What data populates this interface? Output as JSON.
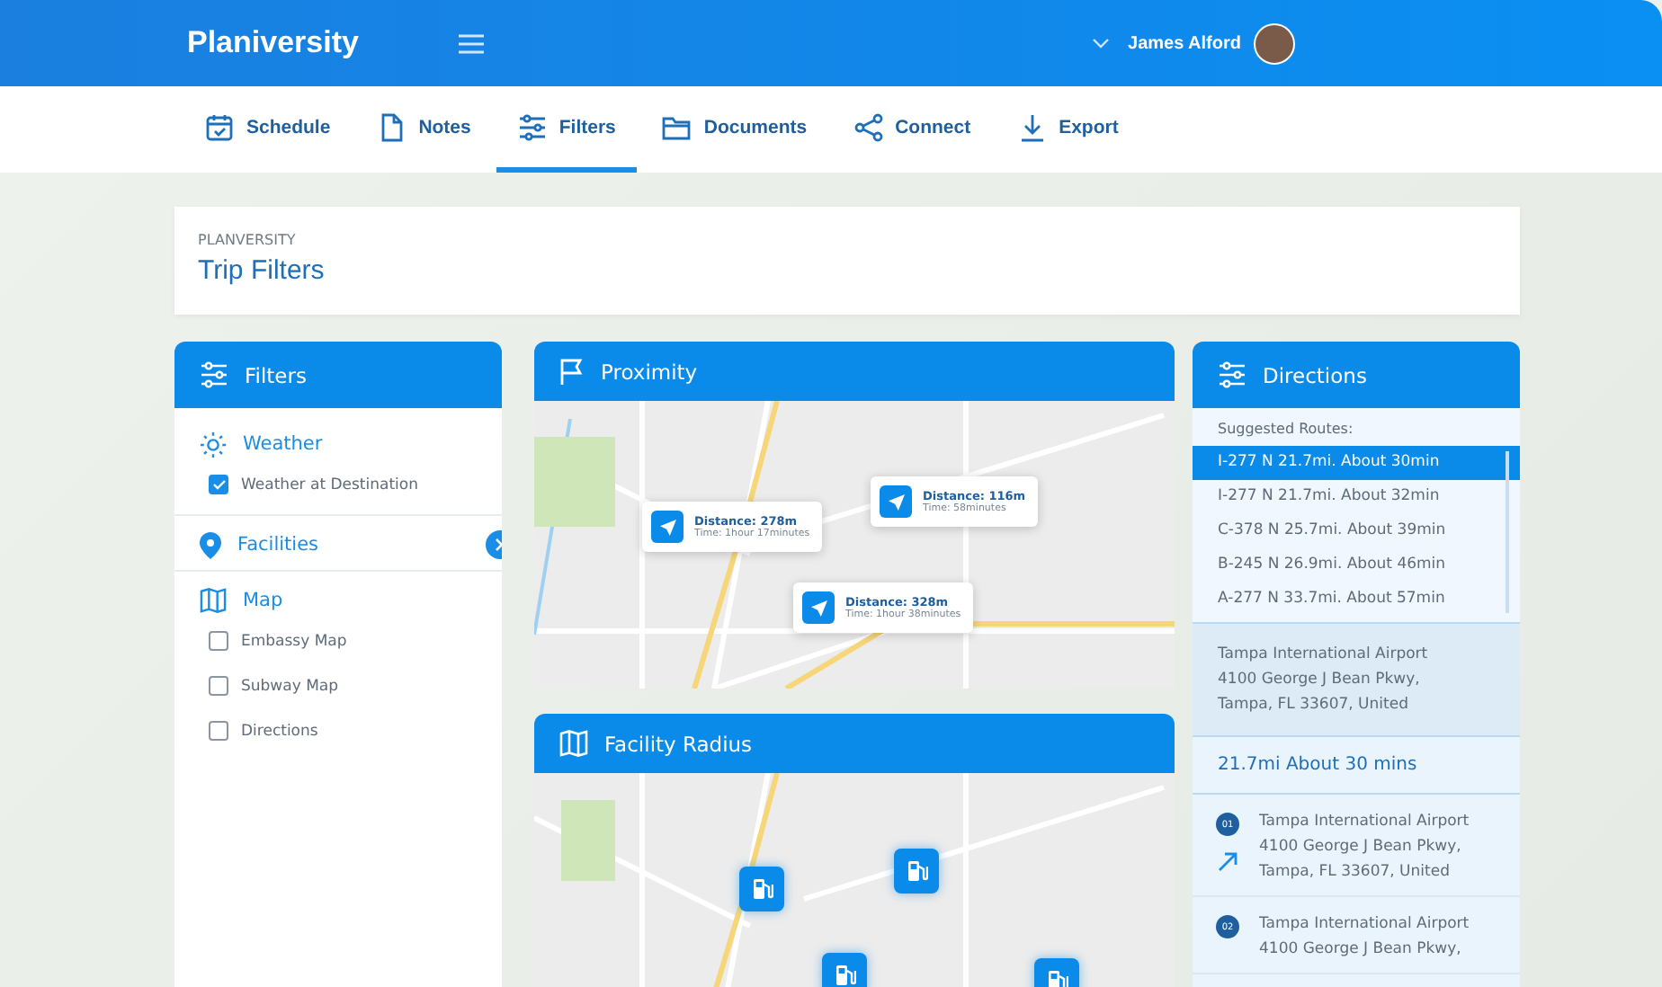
{
  "topbar": {
    "brand": "Planiversity",
    "user": "James Alford"
  },
  "nav": [
    {
      "label": "Schedule",
      "selected": false
    },
    {
      "label": "Notes",
      "selected": false
    },
    {
      "label": "Filters",
      "selected": true
    },
    {
      "label": "Documents",
      "selected": false
    },
    {
      "label": "Connect",
      "selected": false
    },
    {
      "label": "Export",
      "selected": false
    }
  ],
  "header": {
    "eyebrow": "PLANVERSITY",
    "title": "Trip Filters"
  },
  "filters": {
    "title": "Filters",
    "sections": [
      {
        "title": "Weather",
        "expandable": false,
        "items": [
          {
            "label": "Weather at Destination",
            "checked": true
          }
        ]
      },
      {
        "title": "Facilities",
        "expandable": true
      },
      {
        "title": "Map",
        "expandable": false,
        "items": [
          {
            "label": "Embassy Map",
            "checked": false
          },
          {
            "label": "Subway Map",
            "checked": false
          },
          {
            "label": "Directions",
            "checked": false
          }
        ]
      }
    ]
  },
  "proximity": {
    "title": "Proximity",
    "popups": [
      {
        "distance": "Distance: 278m",
        "time": "Time: 1hour 17minutes"
      },
      {
        "distance": "Distance: 116m",
        "time": "Time: 58minutes"
      },
      {
        "distance": "Distance: 328m",
        "time": "Time: 1hour 38minutes"
      }
    ]
  },
  "facility_radius": {
    "title": "Facility Radius"
  },
  "directions": {
    "title": "Directions",
    "routes_label": "Suggested Routes:",
    "routes": [
      {
        "label": "I-277 N 21.7mi. About 30min",
        "selected": true
      },
      {
        "label": "I-277 N 21.7mi. About 32min",
        "selected": false
      },
      {
        "label": "C-378 N 25.7mi. About 39min",
        "selected": false
      },
      {
        "label": "B-245 N 26.9mi. About 46min",
        "selected": false
      },
      {
        "label": "A-277 N 33.7mi. About 57min",
        "selected": false
      }
    ],
    "destination": [
      "Tampa International Airport",
      "4100 George J Bean Pkwy,",
      "Tampa, FL 33607, United"
    ],
    "summary": "21.7mi About 30 mins",
    "steps": [
      {
        "number": "01",
        "lines": [
          "Tampa International Airport",
          "4100 George J Bean Pkwy,",
          "Tampa, FL 33607, United"
        ]
      },
      {
        "number": "02",
        "lines": [
          "Tampa International Airport",
          "4100 George J Bean Pkwy,"
        ]
      }
    ]
  }
}
